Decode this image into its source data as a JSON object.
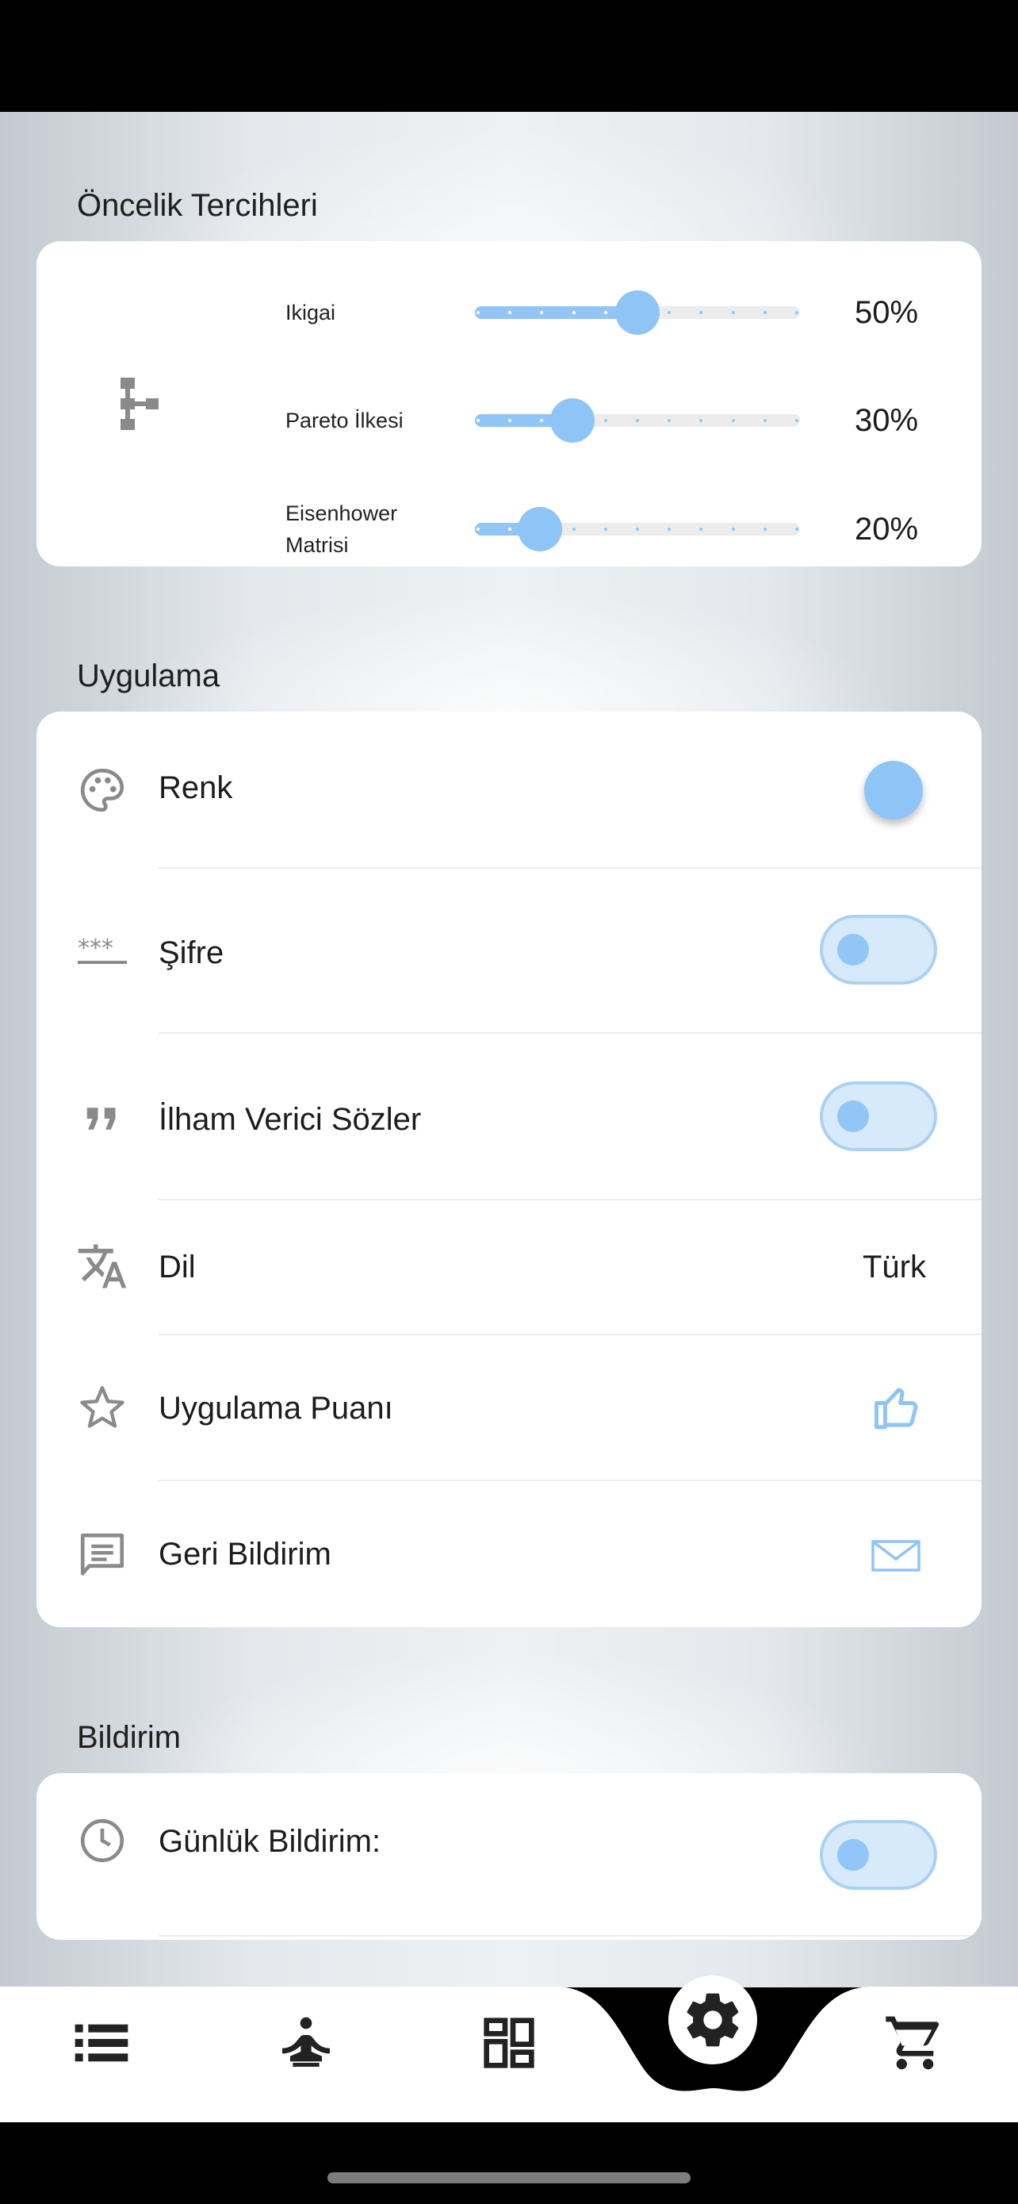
{
  "priority_section": {
    "title": "Öncelik Tercihleri",
    "sliders": [
      {
        "label": "Ikigai",
        "value_text": "50%",
        "fraction": 0.5
      },
      {
        "label": "Pareto İlkesi",
        "value_text": "30%",
        "fraction": 0.3
      },
      {
        "label": "Eisenhower\nMatrisi",
        "value_text": "20%",
        "fraction": 0.2
      }
    ]
  },
  "app_section": {
    "title": "Uygulama",
    "items": [
      {
        "label": "Renk",
        "icon": "palette-icon"
      },
      {
        "label": "Şifre",
        "icon": "password-icon"
      },
      {
        "label": "İlham Verici Sözler",
        "icon": "quote-icon"
      },
      {
        "label": "Dil",
        "icon": "translate-icon",
        "value": "Türk"
      },
      {
        "label": "Uygulama Puanı",
        "icon": "star-icon"
      },
      {
        "label": "Geri Bildirim",
        "icon": "feedback-icon"
      }
    ]
  },
  "notification_section": {
    "title": "Bildirim",
    "items": [
      {
        "label": "Günlük Bildirim:",
        "icon": "clock-icon"
      }
    ]
  },
  "bottom_nav": {
    "items": [
      "list-icon",
      "meditation-icon",
      "dashboard-icon",
      "settings-icon",
      "cart-icon"
    ],
    "active": "settings-icon"
  },
  "colors": {
    "accent": "#8fc4f6",
    "toggle_bg": "#d7eafb",
    "card_bg": "#ffffff",
    "icon_gray": "#8a8a8a"
  }
}
